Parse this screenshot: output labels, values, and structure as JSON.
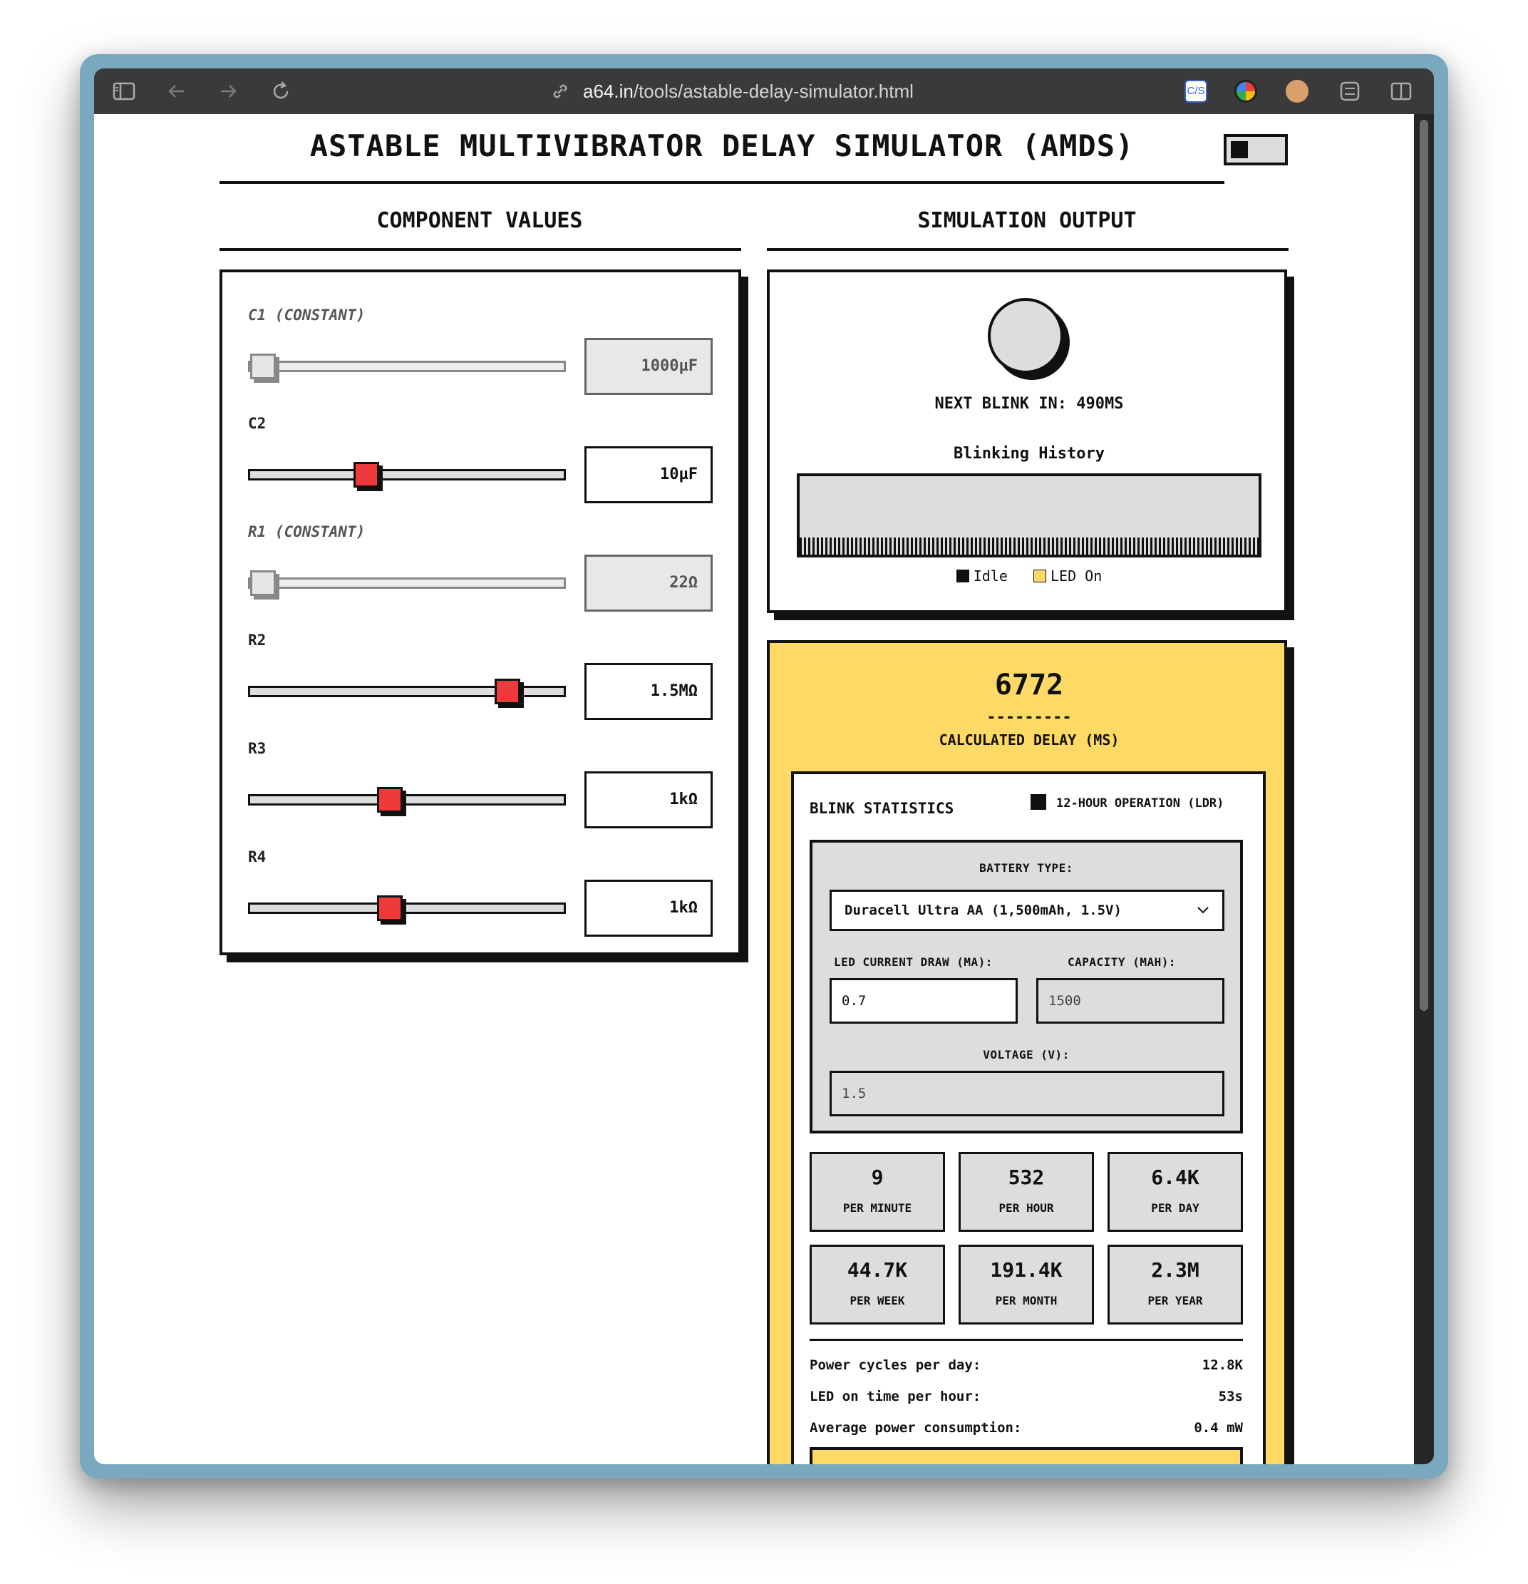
{
  "browser": {
    "url_host": "a64.in",
    "url_path": "/tools/astable-delay-simulator.html",
    "extension_label": "C/S"
  },
  "page": {
    "title": "ASTABLE MULTIVIBRATOR DELAY SIMULATOR (AMDS)"
  },
  "components": {
    "heading": "COMPONENT VALUES",
    "rows": [
      {
        "label": "C1 (CONSTANT)",
        "value": "1000µF",
        "fraction": 0.0,
        "constant": true
      },
      {
        "label": "C2",
        "value": "10µF",
        "fraction": 0.36,
        "constant": false
      },
      {
        "label": "R1 (CONSTANT)",
        "value": "22Ω",
        "fraction": 0.0,
        "constant": true
      },
      {
        "label": "R2",
        "value": "1.5MΩ",
        "fraction": 0.85,
        "constant": false
      },
      {
        "label": "R3",
        "value": "1kΩ",
        "fraction": 0.44,
        "constant": false
      },
      {
        "label": "R4",
        "value": "1kΩ",
        "fraction": 0.44,
        "constant": false
      }
    ]
  },
  "output": {
    "heading": "SIMULATION OUTPUT",
    "next_blink": "NEXT BLINK IN: 490MS",
    "history_title": "Blinking History",
    "legend_idle": "Idle",
    "legend_on": "LED On",
    "colors": {
      "idle": "#111111",
      "led_on": "#ffd966",
      "accent": "#ee3a3a",
      "panel": "#ffd966"
    }
  },
  "delay": {
    "value": "6772",
    "dash": "---------",
    "label": "CALCULATED DELAY (MS)"
  },
  "stats": {
    "title": "BLINK STATISTICS",
    "ldr_label": "12-HOUR OPERATION (LDR)",
    "battery_type_label": "BATTERY TYPE:",
    "battery_selected": "Duracell Ultra AA (1,500mAh, 1.5V)",
    "current_label": "LED CURRENT DRAW (MA):",
    "current_value": "0.7",
    "capacity_label": "CAPACITY (MAH):",
    "capacity_value": "1500",
    "voltage_label": "VOLTAGE (V):",
    "voltage_value": "1.5",
    "tiles": [
      {
        "num": "9",
        "label": "PER MINUTE"
      },
      {
        "num": "532",
        "label": "PER HOUR"
      },
      {
        "num": "6.4K",
        "label": "PER DAY"
      },
      {
        "num": "44.7K",
        "label": "PER WEEK"
      },
      {
        "num": "191.4K",
        "label": "PER MONTH"
      },
      {
        "num": "2.3M",
        "label": "PER YEAR"
      }
    ],
    "summary": [
      {
        "label": "Power cycles per day:",
        "value": "12.8K"
      },
      {
        "label": "LED on time per hour:",
        "value": "53s"
      },
      {
        "label": "Average power consumption:",
        "value": "0.4 mW"
      }
    ]
  }
}
